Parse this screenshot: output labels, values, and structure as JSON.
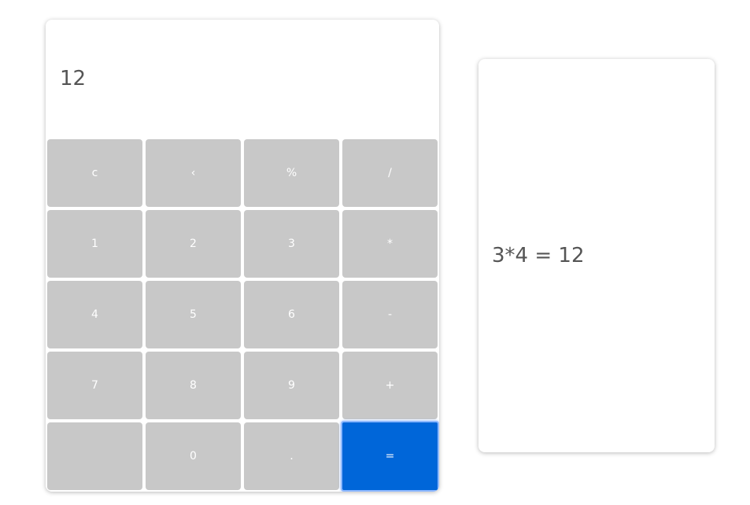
{
  "display": {
    "value": "12"
  },
  "keys": [
    {
      "label": "c",
      "name": "clear-button"
    },
    {
      "label": "‹",
      "name": "backspace-button"
    },
    {
      "label": "%",
      "name": "percent-button"
    },
    {
      "label": "/",
      "name": "divide-button"
    },
    {
      "label": "1",
      "name": "digit-1-button"
    },
    {
      "label": "2",
      "name": "digit-2-button"
    },
    {
      "label": "3",
      "name": "digit-3-button"
    },
    {
      "label": "*",
      "name": "multiply-button"
    },
    {
      "label": "4",
      "name": "digit-4-button"
    },
    {
      "label": "5",
      "name": "digit-5-button"
    },
    {
      "label": "6",
      "name": "digit-6-button"
    },
    {
      "label": "-",
      "name": "subtract-button"
    },
    {
      "label": "7",
      "name": "digit-7-button"
    },
    {
      "label": "8",
      "name": "digit-8-button"
    },
    {
      "label": "9",
      "name": "digit-9-button"
    },
    {
      "label": "+",
      "name": "add-button"
    },
    {
      "label": "",
      "name": "blank-button"
    },
    {
      "label": "0",
      "name": "digit-0-button"
    },
    {
      "label": ".",
      "name": "decimal-button"
    },
    {
      "label": "=",
      "name": "equals-button"
    }
  ],
  "history": {
    "entry": "3*4 = 12"
  },
  "colors": {
    "key": "#c8c8c8",
    "equals": "#0066d9",
    "text": "#555555"
  }
}
